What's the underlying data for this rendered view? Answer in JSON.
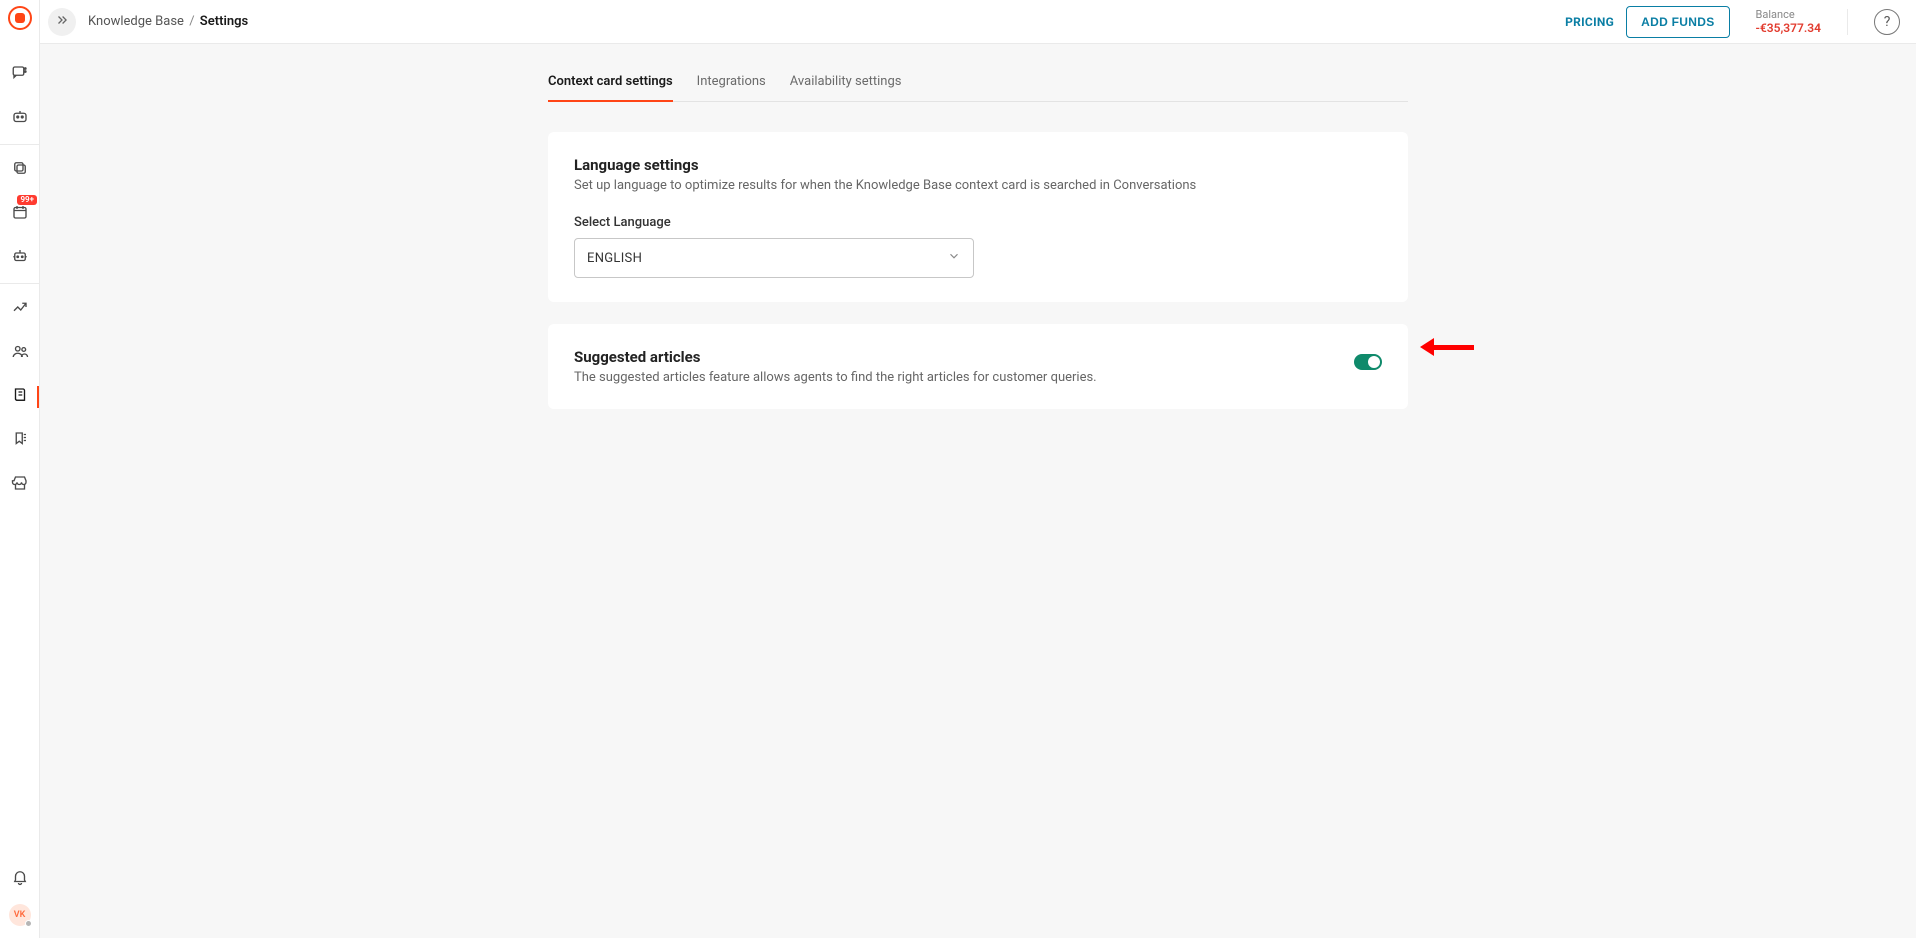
{
  "breadcrumb": {
    "parent": "Knowledge Base",
    "current": "Settings"
  },
  "topbar": {
    "pricing": "PRICING",
    "add_funds": "ADD FUNDS",
    "balance_label": "Balance",
    "balance_value": "-€35,377.34"
  },
  "sidebar": {
    "badge": "99+",
    "avatar_initials": "VK"
  },
  "tabs": [
    {
      "label": "Context card settings",
      "active": true
    },
    {
      "label": "Integrations",
      "active": false
    },
    {
      "label": "Availability settings",
      "active": false
    }
  ],
  "language_card": {
    "title": "Language settings",
    "subtitle": "Set up language to optimize results for when the Knowledge Base context card is searched in Conversations",
    "field_label": "Select Language",
    "selected": "ENGLISH"
  },
  "suggested_card": {
    "title": "Suggested articles",
    "subtitle": "The suggested articles feature allows agents to find the right articles for customer queries.",
    "enabled": true
  }
}
